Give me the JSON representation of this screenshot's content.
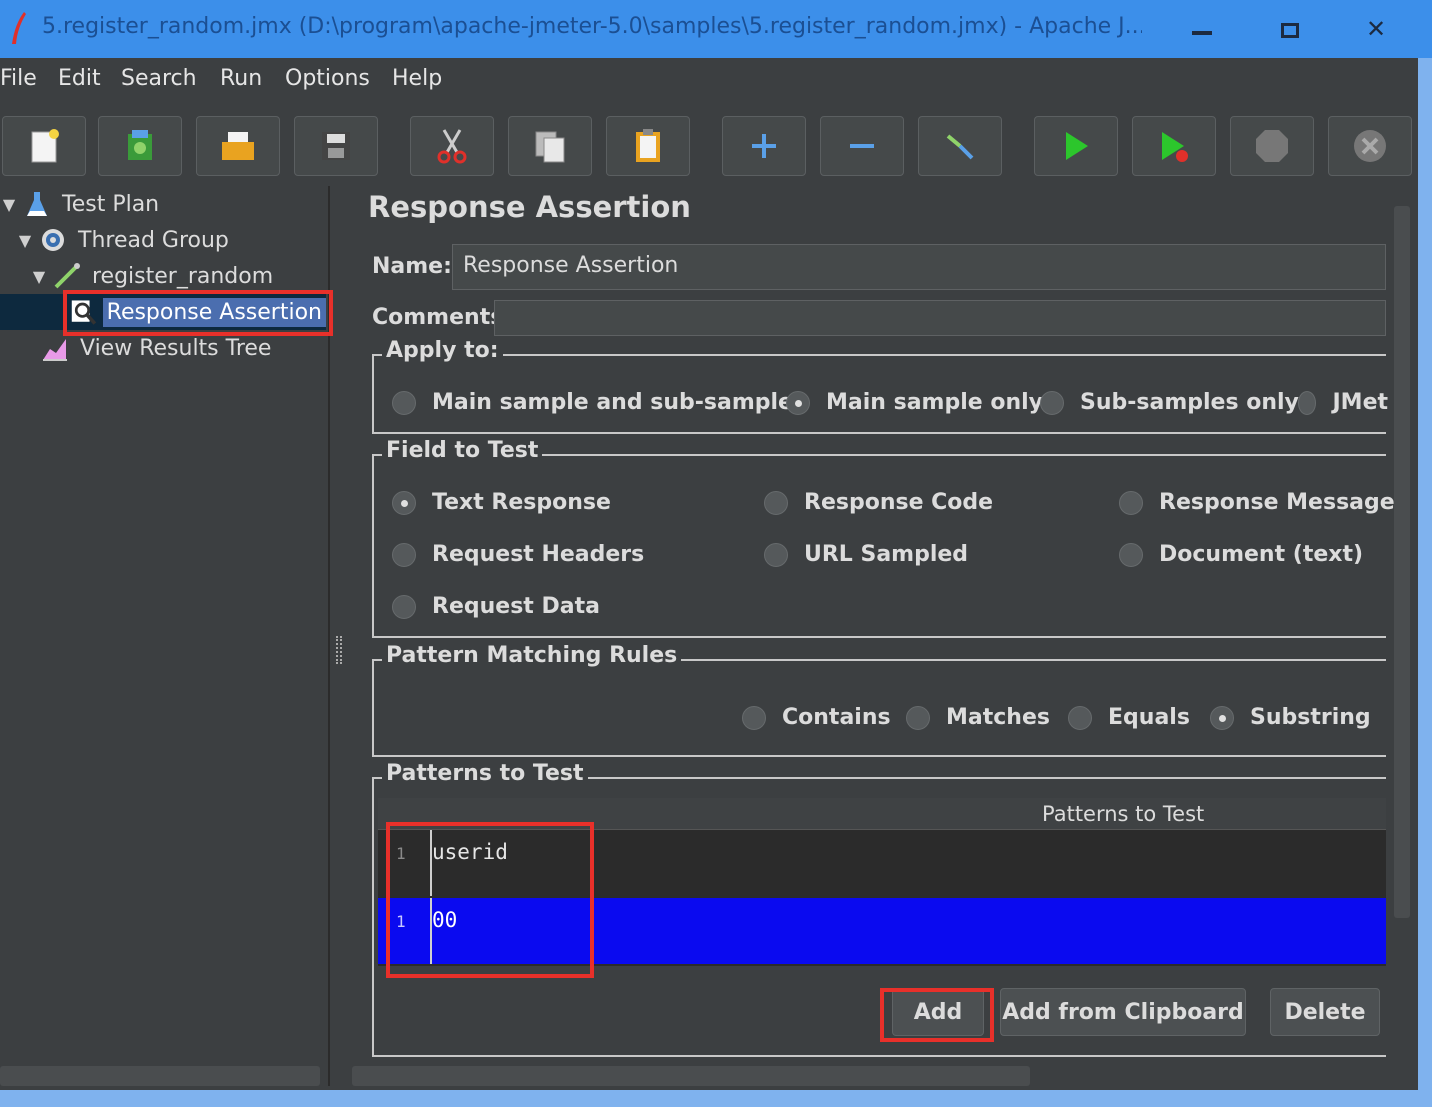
{
  "window": {
    "title": "5.register_random.jmx (D:\\program\\apache-jmeter-5.0\\samples\\5.register_random.jmx) - Apache J..."
  },
  "menu": [
    {
      "label": "File"
    },
    {
      "label": "Edit"
    },
    {
      "label": "Search"
    },
    {
      "label": "Run"
    },
    {
      "label": "Options"
    },
    {
      "label": "Help"
    }
  ],
  "toolbar": [
    {
      "icon": "new-icon"
    },
    {
      "icon": "templates-icon"
    },
    {
      "icon": "open-icon"
    },
    {
      "icon": "save-icon"
    },
    {
      "icon": "cut-icon"
    },
    {
      "icon": "copy-icon"
    },
    {
      "icon": "paste-icon"
    },
    {
      "icon": "expand-icon"
    },
    {
      "icon": "collapse-icon"
    },
    {
      "icon": "toggle-icon"
    },
    {
      "icon": "start-icon"
    },
    {
      "icon": "start-no-pauses-icon"
    },
    {
      "icon": "stop-icon"
    },
    {
      "icon": "shutdown-icon"
    }
  ],
  "tree": {
    "items": [
      {
        "label": "Test Plan",
        "icon": "flask-icon"
      },
      {
        "label": "Thread Group",
        "icon": "gear-icon"
      },
      {
        "label": "register_random",
        "icon": "pipette-icon"
      },
      {
        "label": "Response Assertion",
        "icon": "magnifier-icon"
      },
      {
        "label": "View Results Tree",
        "icon": "chart-icon"
      }
    ]
  },
  "panel": {
    "title": "Response Assertion",
    "name_label": "Name:",
    "name_value": "Response Assertion",
    "comments_label": "Comments:",
    "comments_value": "",
    "apply_to": {
      "title": "Apply to:",
      "options": [
        "Main sample and sub-samples",
        "Main sample only",
        "Sub-samples only",
        "JMet"
      ],
      "selected": "Main sample only"
    },
    "field_to_test": {
      "title": "Field to Test",
      "options": [
        "Text Response",
        "Response Code",
        "Response Message",
        "Request Headers",
        "URL Sampled",
        "Document (text)",
        "Request Data"
      ],
      "selected": "Text Response"
    },
    "pattern_rules": {
      "title": "Pattern Matching Rules",
      "options": [
        "Contains",
        "Matches",
        "Equals",
        "Substring"
      ],
      "selected": "Substring"
    },
    "patterns": {
      "title": "Patterns to Test",
      "column_header": "Patterns to Test",
      "rows": [
        {
          "line": "1",
          "value": "userid"
        },
        {
          "line": "1",
          "value": "00"
        }
      ]
    },
    "buttons": {
      "add": "Add",
      "add_clipboard": "Add from Clipboard",
      "delete": "Delete"
    }
  },
  "colors": {
    "titlebar": "#3c8fea",
    "background": "#3c3f41",
    "selection_blue": "#0a0af0",
    "highlight_red": "#e8302a"
  }
}
